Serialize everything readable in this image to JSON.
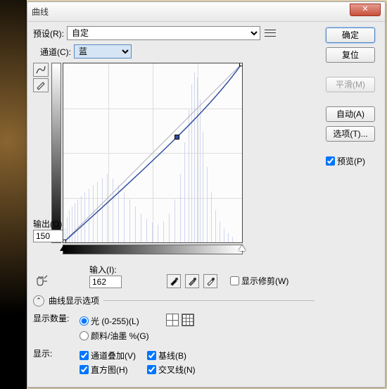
{
  "title": "曲线",
  "preset": {
    "label": "预设(R):",
    "value": "自定"
  },
  "channel": {
    "label": "通道(C):",
    "value": "蓝"
  },
  "buttons": {
    "ok": "确定",
    "reset": "复位",
    "smooth": "平滑(M)",
    "auto": "自动(A)",
    "options": "选项(T)..."
  },
  "preview": {
    "label": "预览(P)",
    "checked": true
  },
  "output": {
    "label": "输出(O):",
    "value": "150"
  },
  "input": {
    "label": "输入(I):",
    "value": "162"
  },
  "show_clip": {
    "label": "显示修剪(W)",
    "checked": false
  },
  "options_toggle": "曲线显示选项",
  "display_amount": {
    "label": "显示数量:",
    "light": "光 (0-255)(L)",
    "pigment": "颜料/油墨 %(G)"
  },
  "show": {
    "label": "显示:",
    "channel_overlay": "通道叠加(V)",
    "baseline": "基线(B)",
    "histogram": "直方图(H)",
    "intersection": "交叉线(N)"
  },
  "chart_data": {
    "type": "curve",
    "xlim": [
      0,
      255
    ],
    "ylim": [
      0,
      255
    ],
    "grid": 4,
    "points": [
      {
        "input": 0,
        "output": 0
      },
      {
        "input": 162,
        "output": 150
      },
      {
        "input": 255,
        "output": 255
      }
    ],
    "selected_point": 1,
    "baseline": true
  }
}
